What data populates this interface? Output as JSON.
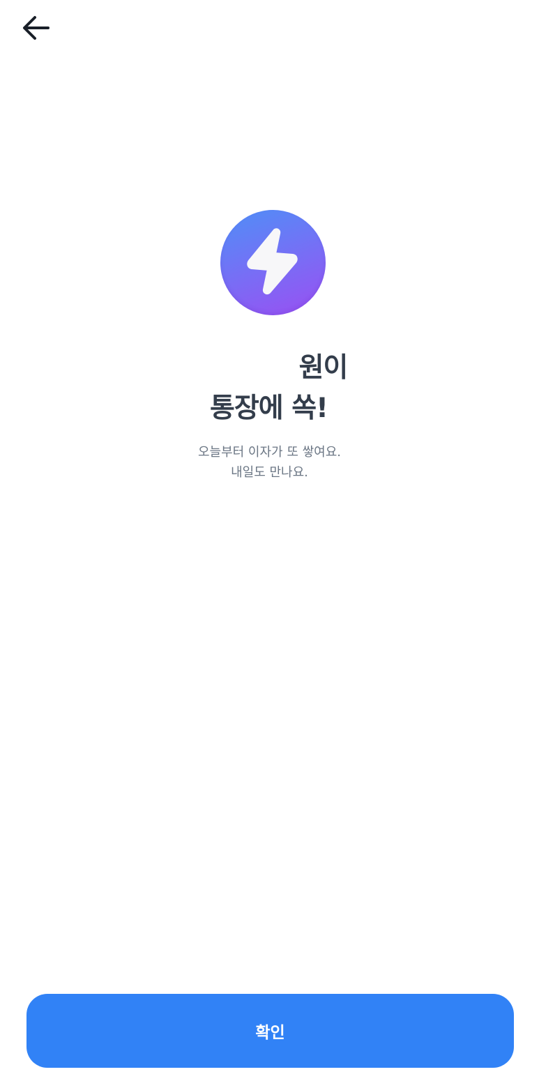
{
  "header": {
    "back_icon": "arrow-left-icon"
  },
  "hero": {
    "icon": "lightning-bolt-icon",
    "colors": {
      "gradient_start": "#4f8ff7",
      "gradient_end": "#9a4ff2",
      "bolt": "#f7f7f9"
    }
  },
  "message": {
    "headline_line1": "원이",
    "headline_line2": "통장에 쏙!",
    "description_line1": "오늘부터 이자가 또 쌓여요.",
    "description_line2": "내일도 만나요."
  },
  "footer": {
    "confirm_label": "확인",
    "confirm_color": "#3182f6"
  }
}
